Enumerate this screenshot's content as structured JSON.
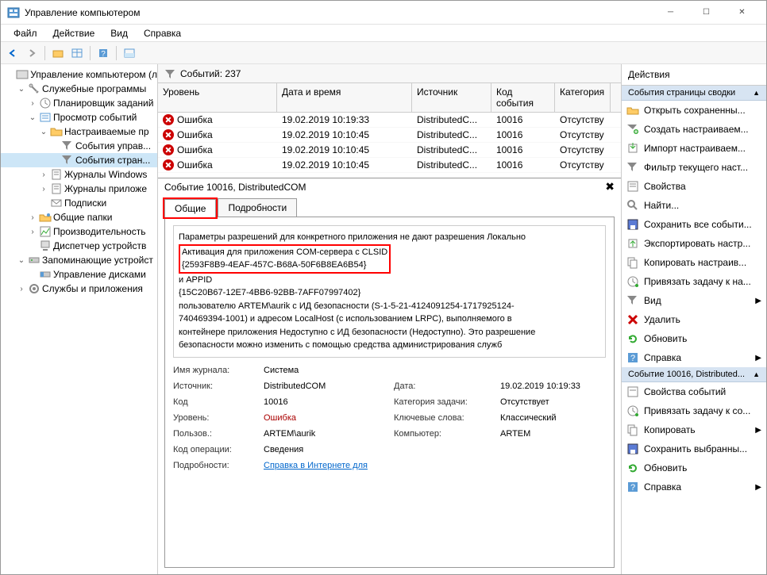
{
  "title": "Управление компьютером",
  "menu": [
    "Файл",
    "Действие",
    "Вид",
    "Справка"
  ],
  "tree": [
    {
      "lvl": 0,
      "exp": "",
      "icon": "mgmt",
      "label": "Управление компьютером (л"
    },
    {
      "lvl": 1,
      "exp": "v",
      "icon": "tools",
      "label": "Служебные программы"
    },
    {
      "lvl": 2,
      "exp": ">",
      "icon": "sched",
      "label": "Планировщик заданий"
    },
    {
      "lvl": 2,
      "exp": "v",
      "icon": "event",
      "label": "Просмотр событий"
    },
    {
      "lvl": 3,
      "exp": "v",
      "icon": "folder",
      "label": "Настраиваемые пр"
    },
    {
      "lvl": 4,
      "exp": "",
      "icon": "view",
      "label": "События управ..."
    },
    {
      "lvl": 4,
      "exp": "",
      "icon": "view",
      "label": "События стран...",
      "sel": true
    },
    {
      "lvl": 3,
      "exp": ">",
      "icon": "log",
      "label": "Журналы Windows"
    },
    {
      "lvl": 3,
      "exp": ">",
      "icon": "log",
      "label": "Журналы приложе"
    },
    {
      "lvl": 3,
      "exp": "",
      "icon": "sub",
      "label": "Подписки"
    },
    {
      "lvl": 2,
      "exp": ">",
      "icon": "share",
      "label": "Общие папки"
    },
    {
      "lvl": 2,
      "exp": ">",
      "icon": "perf",
      "label": "Производительность"
    },
    {
      "lvl": 2,
      "exp": "",
      "icon": "devmgr",
      "label": "Диспетчер устройств"
    },
    {
      "lvl": 1,
      "exp": "v",
      "icon": "store",
      "label": "Запоминающие устройст"
    },
    {
      "lvl": 2,
      "exp": "",
      "icon": "disk",
      "label": "Управление дисками"
    },
    {
      "lvl": 1,
      "exp": ">",
      "icon": "svc",
      "label": "Службы и приложения"
    }
  ],
  "events_count_label": "Событий: 237",
  "event_cols": [
    "Уровень",
    "Дата и время",
    "Источник",
    "Код события",
    "Категория"
  ],
  "events": [
    {
      "lvl": "Ошибка",
      "dt": "19.02.2019 10:19:33",
      "src": "DistributedC...",
      "code": "10016",
      "cat": "Отсутству"
    },
    {
      "lvl": "Ошибка",
      "dt": "19.02.2019 10:10:45",
      "src": "DistributedC...",
      "code": "10016",
      "cat": "Отсутству"
    },
    {
      "lvl": "Ошибка",
      "dt": "19.02.2019 10:10:45",
      "src": "DistributedC...",
      "code": "10016",
      "cat": "Отсутству"
    },
    {
      "lvl": "Ошибка",
      "dt": "19.02.2019 10:10:45",
      "src": "DistributedC...",
      "code": "10016",
      "cat": "Отсутству"
    }
  ],
  "detail_title": "Событие 10016, DistributedCOM",
  "tabs": [
    "Общие",
    "Подробности"
  ],
  "desc": {
    "line1": "Параметры разрешений для конкретного приложения не дают разрешения Локально",
    "red_line1": "Активация для приложения COM-сервера с CLSID",
    "red_line2": "{2593F8B9-4EAF-457C-B68A-50F6B8EA6B54}",
    "line4": "и APPID",
    "line5": "{15C20B67-12E7-4BB6-92BB-7AFF07997402}",
    "line6": " пользователю ARTEM\\aurik с ИД безопасности (S-1-5-21-4124091254-1717925124-",
    "line7": "740469394-1001) и адресом LocalHost (с использованием LRPC), выполняемого в",
    "line8": "контейнере приложения Недоступно с ИД безопасности (Недоступно). Это разрешение",
    "line9": "безопасности можно изменить с помощью средства администрирования служб"
  },
  "fields": {
    "log_name_l": "Имя журнала:",
    "log_name_v": "Система",
    "source_l": "Источник:",
    "source_v": "DistributedCOM",
    "date_l": "Дата:",
    "date_v": "19.02.2019 10:19:33",
    "code_l": "Код",
    "code_v": "10016",
    "cat_l": "Категория задачи:",
    "cat_v": "Отсутствует",
    "level_l": "Уровень:",
    "level_v": "Ошибка",
    "kw_l": "Ключевые слова:",
    "kw_v": "Классический",
    "user_l": "Пользов.:",
    "user_v": "ARTEM\\aurik",
    "comp_l": "Компьютер:",
    "comp_v": "ARTEM",
    "op_l": "Код операции:",
    "op_v": "Сведения",
    "more_l": "Подробности:",
    "more_v": "Справка в Интернете для "
  },
  "actions_title": "Действия",
  "section1": "События страницы сводки",
  "section1_items": [
    {
      "icon": "open",
      "label": "Открыть сохраненны..."
    },
    {
      "icon": "create",
      "label": "Создать настраиваем..."
    },
    {
      "icon": "import",
      "label": "Импорт настраиваем..."
    },
    {
      "icon": "filter",
      "label": "Фильтр текущего наст..."
    },
    {
      "icon": "props",
      "label": "Свойства"
    },
    {
      "icon": "find",
      "label": "Найти..."
    },
    {
      "icon": "saveall",
      "label": "Сохранить все событи..."
    },
    {
      "icon": "export",
      "label": "Экспортировать настр..."
    },
    {
      "icon": "copy",
      "label": "Копировать настраив..."
    },
    {
      "icon": "bind",
      "label": "Привязать задачу к на..."
    },
    {
      "icon": "view",
      "label": "Вид",
      "arrow": true
    },
    {
      "icon": "delete",
      "label": "Удалить"
    },
    {
      "icon": "refresh",
      "label": "Обновить"
    },
    {
      "icon": "help",
      "label": "Справка",
      "arrow": true
    }
  ],
  "section2": "Событие 10016, Distributed...",
  "section2_items": [
    {
      "icon": "evprops",
      "label": "Свойства событий"
    },
    {
      "icon": "bind",
      "label": "Привязать задачу к со..."
    },
    {
      "icon": "copy",
      "label": "Копировать",
      "arrow": true
    },
    {
      "icon": "savesel",
      "label": "Сохранить выбранны..."
    },
    {
      "icon": "refresh",
      "label": "Обновить"
    },
    {
      "icon": "help",
      "label": "Справка",
      "arrow": true
    }
  ]
}
